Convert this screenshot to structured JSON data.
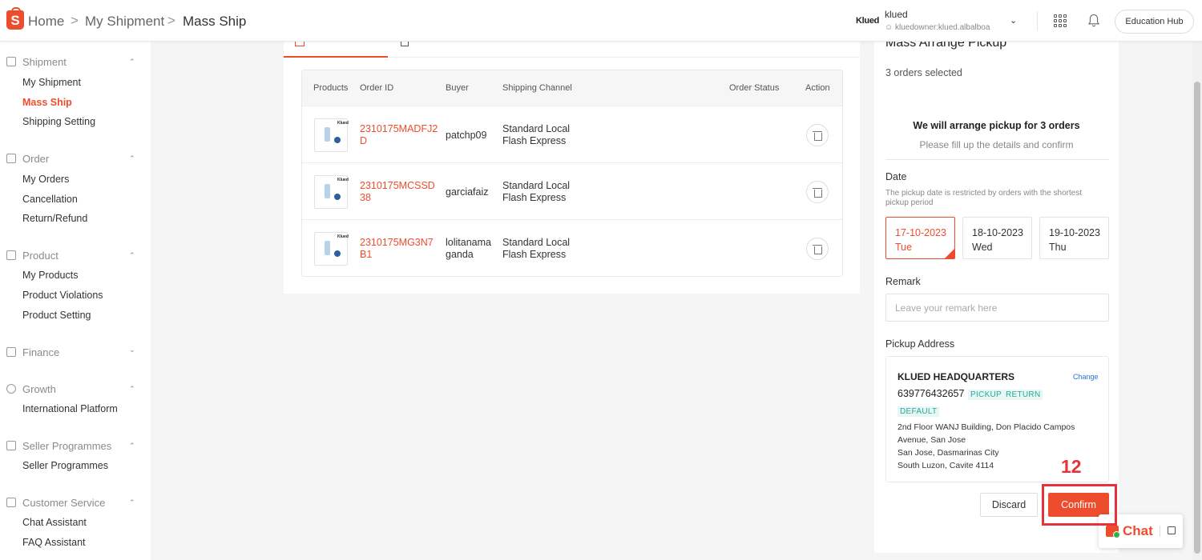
{
  "header": {
    "logo": "S",
    "breadcrumb": [
      "Home",
      "My Shipment",
      "Mass Ship"
    ],
    "user": {
      "logo_text": "Klued",
      "name": "klued",
      "account": "kluedowner:klued.albalboa"
    },
    "education_hub": "Education Hub"
  },
  "sidebar": {
    "groups": [
      {
        "label": "Shipment",
        "items": [
          "My Shipment",
          "Mass Ship",
          "Shipping Setting"
        ],
        "active": "Mass Ship"
      },
      {
        "label": "Order",
        "items": [
          "My Orders",
          "Cancellation",
          "Return/Refund"
        ]
      },
      {
        "label": "Product",
        "items": [
          "My Products",
          "Product Violations",
          "Product Setting"
        ]
      },
      {
        "label": "Finance",
        "items": []
      },
      {
        "label": "Growth",
        "items": [
          "International Platform"
        ]
      },
      {
        "label": "Seller Programmes",
        "items": [
          "Seller Programmes"
        ]
      },
      {
        "label": "Customer Service",
        "items": [
          "Chat Assistant",
          "FAQ Assistant"
        ]
      }
    ]
  },
  "orders_table": {
    "columns": [
      "Products",
      "Order ID",
      "Buyer",
      "Shipping Channel",
      "Order Status",
      "Action"
    ],
    "rows": [
      {
        "thumb_label": "Klued",
        "order_id": "2310175MADFJ2D",
        "buyer": "patchp09",
        "channel_1": "Standard Local",
        "channel_2": "Flash Express"
      },
      {
        "thumb_label": "Klued",
        "order_id": "2310175MCSSD38",
        "buyer": "garciafaiz",
        "channel_1": "Standard Local",
        "channel_2": "Flash Express"
      },
      {
        "thumb_label": "Klued",
        "order_id": "2310175MG3N7B1",
        "buyer": "lolitanamaganda",
        "channel_1": "Standard Local",
        "channel_2": "Flash Express"
      }
    ]
  },
  "right_panel": {
    "title": "Mass Arrange Pickup",
    "selected": "3 orders selected",
    "arrange_msg": "We will arrange pickup for 3 orders",
    "fill_msg": "Please fill up the details and confirm",
    "date_label": "Date",
    "date_note": "The pickup date is restricted by orders with the shortest pickup period",
    "dates": [
      {
        "date": "17-10-2023",
        "day": "Tue",
        "selected": true
      },
      {
        "date": "18-10-2023",
        "day": "Wed",
        "selected": false
      },
      {
        "date": "19-10-2023",
        "day": "Thu",
        "selected": false
      }
    ],
    "remark_label": "Remark",
    "remark_placeholder": "Leave your remark here",
    "remark_value": "",
    "address_label": "Pickup Address",
    "address": {
      "name": "KLUED HEADQUARTERS",
      "change": "Change",
      "phone": "639776432657",
      "tags": [
        "PICKUP",
        "RETURN",
        "DEFAULT"
      ],
      "lines": [
        "2nd Floor WANJ Building, Don Placido Campos",
        "Avenue, San Jose",
        "San Jose, Dasmarinas City",
        "South Luzon, Cavite 4114"
      ]
    },
    "discard": "Discard",
    "confirm": "Confirm"
  },
  "annotation": {
    "label": "12",
    "color": "#e5323b"
  },
  "chat_widget": {
    "label": "Chat"
  },
  "colors": {
    "accent": "#ee4d2d",
    "tag": "#26aa99",
    "link": "#2673dd"
  }
}
